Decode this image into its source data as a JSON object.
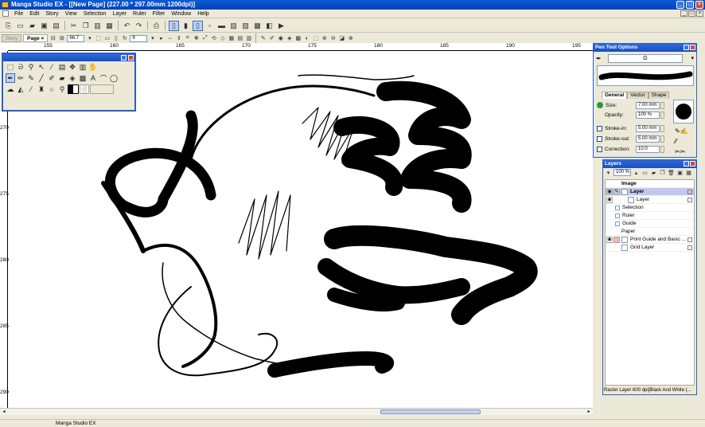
{
  "window": {
    "title": "Manga Studio EX - [[New Page] (227.00 * 297.00mm 1200dpi)]"
  },
  "menu": [
    "File",
    "Edit",
    "Story",
    "View",
    "Selection",
    "Layer",
    "Ruler",
    "Filter",
    "Window",
    "Help"
  ],
  "tabs": {
    "story": "Story",
    "page": "Page",
    "page_close": "×"
  },
  "toolbar2": {
    "zoom_value": "66.7",
    "rotate_value": "9"
  },
  "rulers": {
    "horizontal": [
      "155",
      "160",
      "165",
      "170",
      "175",
      "180",
      "185",
      "190",
      "195"
    ],
    "vertical": [
      "270",
      "275",
      "280",
      "285",
      "290"
    ]
  },
  "tool_options": {
    "title": "Pen Tool Options",
    "brush_name": "G",
    "tabs": [
      "General",
      "Vector",
      "Shape"
    ],
    "size": {
      "label": "Size:",
      "value": "7.00 mm"
    },
    "opacity": {
      "label": "Opacity:",
      "value": "100 %"
    },
    "stroke_in": {
      "label": "Stroke-in:",
      "value": "5.00 mm"
    },
    "stroke_out": {
      "label": "Stroke-out:",
      "value": "5.00 mm"
    },
    "correction": {
      "label": "Correction:",
      "value": "10.0"
    }
  },
  "layers": {
    "title": "Layers",
    "opacity": "100 %",
    "items": [
      {
        "name": "Image",
        "type": "folder"
      },
      {
        "name": "Layer",
        "type": "layer",
        "selected": true
      },
      {
        "name": "Layer",
        "type": "sublayer"
      },
      {
        "name": "Selection",
        "type": "folder"
      },
      {
        "name": "Ruler",
        "type": "folder"
      },
      {
        "name": "Guide",
        "type": "folder"
      },
      {
        "name": "Paper",
        "type": "folder"
      },
      {
        "name": "Print Guide and Basic ...",
        "type": "layer"
      },
      {
        "name": "Grid Layer",
        "type": "layer"
      }
    ],
    "status": "Raster Layer 600 dpi[Black And White (..."
  },
  "statusbar": {
    "app": "Manga Studio EX"
  },
  "colors": {
    "title_bar": "#0541b8",
    "panel": "#ece9d8",
    "selected_layer": "#c0c8f0"
  }
}
